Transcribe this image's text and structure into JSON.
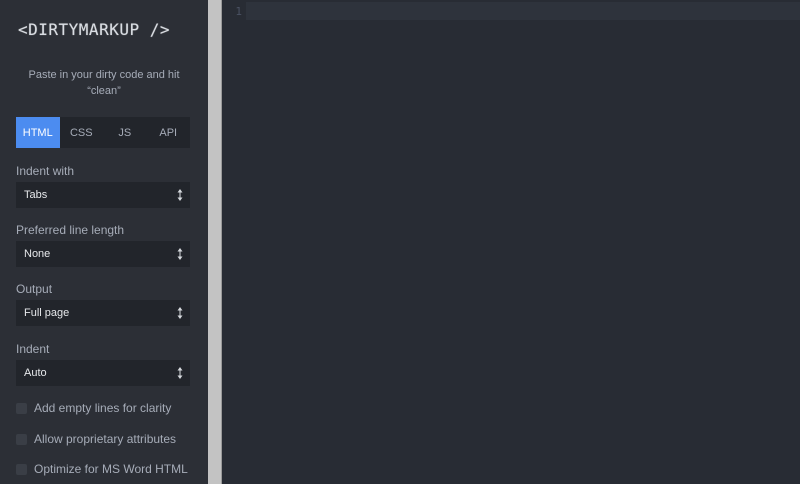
{
  "app": {
    "logo_text": "<DIRTYMARKUP />",
    "tagline": "Paste in your dirty code and hit “clean”"
  },
  "tabs": [
    {
      "label": "HTML",
      "active": true
    },
    {
      "label": "CSS",
      "active": false
    },
    {
      "label": "JS",
      "active": false
    },
    {
      "label": "API",
      "active": false
    }
  ],
  "options": {
    "indent_with": {
      "label": "Indent with",
      "value": "Tabs"
    },
    "line_length": {
      "label": "Preferred line length",
      "value": "None"
    },
    "output": {
      "label": "Output",
      "value": "Full page"
    },
    "indent": {
      "label": "Indent",
      "value": "Auto"
    }
  },
  "checkboxes": [
    {
      "label": "Add empty lines for clarity",
      "checked": false
    },
    {
      "label": "Allow proprietary attributes",
      "checked": false
    },
    {
      "label": "Optimize for MS Word HTML",
      "checked": false
    }
  ],
  "editor": {
    "line_numbers": [
      "1"
    ],
    "content": ""
  },
  "colors": {
    "accent": "#4c8cf0",
    "sidebar_bg": "#2c2f36",
    "editor_bg": "#282c34"
  }
}
